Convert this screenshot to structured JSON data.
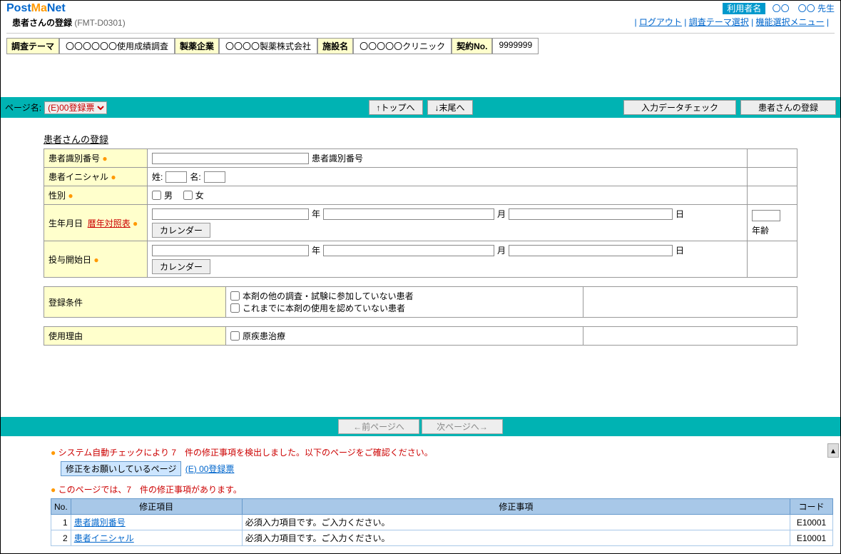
{
  "logo": {
    "p1": "Post",
    "p2": "Ma",
    "p3": "Net"
  },
  "subtitle": "患者さんの登録",
  "subtitle_code": "(FMT-D0301)",
  "user": {
    "label": "利用者名",
    "name": "〇〇　〇〇 先生"
  },
  "nav": {
    "logout": "ログアウト",
    "theme": "調査テーマ選択",
    "menu": "機能選択メニュー"
  },
  "info": {
    "theme_l": "調査テーマ",
    "theme_v": "〇〇〇〇〇〇使用成績調査",
    "company_l": "製薬企業",
    "company_v": "〇〇〇〇製薬株式会社",
    "facility_l": "施設名",
    "facility_v": "〇〇〇〇〇クリニック",
    "contract_l": "契約No.",
    "contract_v": "9999999"
  },
  "pagebar": {
    "page_label": "ページ名:",
    "select_value": "(E)00登録票",
    "btn_top": "↑トップへ",
    "btn_end": "↓末尾へ",
    "btn_check": "入力データチェック",
    "btn_register": "患者さんの登録"
  },
  "section_title": "患者さんの登録",
  "form": {
    "patient_id_l": "患者識別番号",
    "patient_id_suffix": "患者識別番号",
    "initials_l": "患者イニシャル",
    "surname": "姓:",
    "given": "名:",
    "sex_l": "性別",
    "male": "男",
    "female": "女",
    "dob_l": "生年月日",
    "era_link": "暦年対照表",
    "year": "年",
    "month": "月",
    "day": "日",
    "calendar": "カレンダー",
    "age_suffix": "年齢",
    "start_l": "投与開始日",
    "cond_l": "登録条件",
    "cond1": "本剤の他の調査・試験に参加していない患者",
    "cond2": "これまでに本剤の使用を認めていない患者",
    "reason_l": "使用理由",
    "reason1": "原疾患治療"
  },
  "navbtns": {
    "prev": "←前ページへ",
    "next": "次ページへ→"
  },
  "check": {
    "sys_msg": "システム自動チェックにより 7　件の修正事項を検出しました。以下のページをご確認ください。",
    "fix_label": "修正をお願いしているページ",
    "fix_link": "(E) 00登録票",
    "page_msg": "このページでは、7　件の修正事項があります。",
    "th_no": "No.",
    "th_item": "修正項目",
    "th_issue": "修正事項",
    "th_code": "コード",
    "rows": [
      {
        "no": "1",
        "item": "患者識別番号",
        "issue": "必須入力項目です。ご入力ください。",
        "code": "E10001"
      },
      {
        "no": "2",
        "item": "患者イニシャル",
        "issue": "必須入力項目です。ご入力ください。",
        "code": "E10001"
      }
    ]
  }
}
